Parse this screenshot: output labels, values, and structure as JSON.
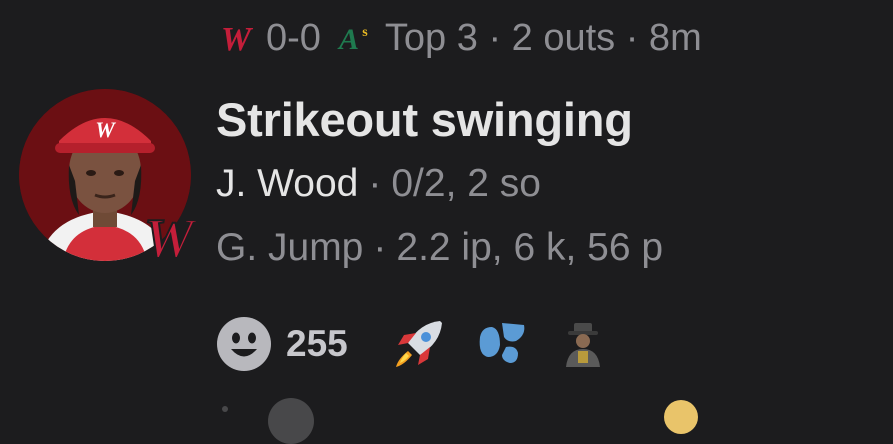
{
  "game": {
    "home_logo": "W",
    "score": "0-0",
    "away_logo": "A's",
    "status": "Top 3 · 2 outs · 8m"
  },
  "play": {
    "title": "Strikeout swinging",
    "batter_name": "J. Wood",
    "batter_stats": "0/2, 2 so",
    "pitcher_name": "G. Jump",
    "pitcher_stats": "2.2 ip, 6 k, 56 p"
  },
  "reactions": {
    "count": "255",
    "items": [
      "rocket-icon",
      "droplets-icon",
      "person-hat-icon"
    ]
  },
  "colors": {
    "background": "#1c1c1e",
    "nationals_red": "#c41e3a",
    "athletics_green": "#1f7a4f",
    "secondary_text": "#8e8e93",
    "primary_text": "#e5e5e5"
  }
}
